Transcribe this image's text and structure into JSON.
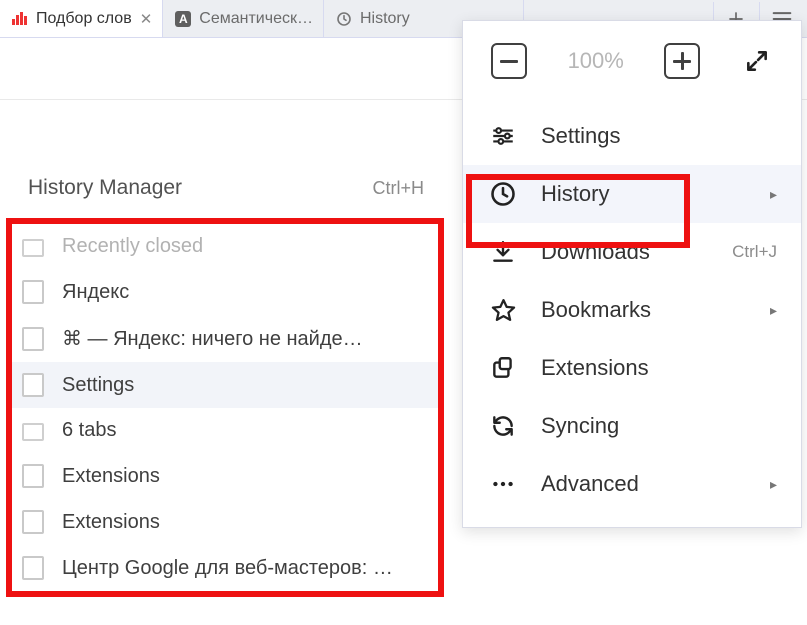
{
  "tabs": {
    "items": [
      {
        "title": "Подбор слов",
        "favicon": "bars",
        "active": true
      },
      {
        "title": "Семантическ…",
        "favicon": "letter-a",
        "active": false
      },
      {
        "title": "History",
        "favicon": "clock",
        "active": false
      }
    ]
  },
  "history_popup": {
    "title": "History Manager",
    "shortcut": "Ctrl+H",
    "items": [
      {
        "label": "Recently closed",
        "icon": "folder",
        "faded": true
      },
      {
        "label": "Яндекс",
        "icon": "page"
      },
      {
        "label": "⌘ — Яндекс: ничего не найде…",
        "icon": "page"
      },
      {
        "label": "Settings",
        "icon": "page",
        "hover": true
      },
      {
        "label": "6 tabs",
        "icon": "folder"
      },
      {
        "label": "Extensions",
        "icon": "page"
      },
      {
        "label": "Extensions",
        "icon": "page"
      },
      {
        "label": "Центр Google для веб-мастеров: …",
        "icon": "page"
      }
    ]
  },
  "main_menu": {
    "zoom_pct": "100%",
    "items": [
      {
        "label": "Settings",
        "icon": "sliders",
        "shortcut": "",
        "sub": false
      },
      {
        "label": "History",
        "icon": "clock",
        "shortcut": "",
        "sub": true,
        "hovered": true
      },
      {
        "label": "Downloads",
        "icon": "download",
        "shortcut": "Ctrl+J",
        "sub": false
      },
      {
        "label": "Bookmarks",
        "icon": "star",
        "shortcut": "",
        "sub": true
      },
      {
        "label": "Extensions",
        "icon": "extensions",
        "shortcut": "",
        "sub": false
      },
      {
        "label": "Syncing",
        "icon": "sync",
        "shortcut": "",
        "sub": false
      },
      {
        "label": "Advanced",
        "icon": "dots",
        "shortcut": "",
        "sub": true
      }
    ]
  }
}
